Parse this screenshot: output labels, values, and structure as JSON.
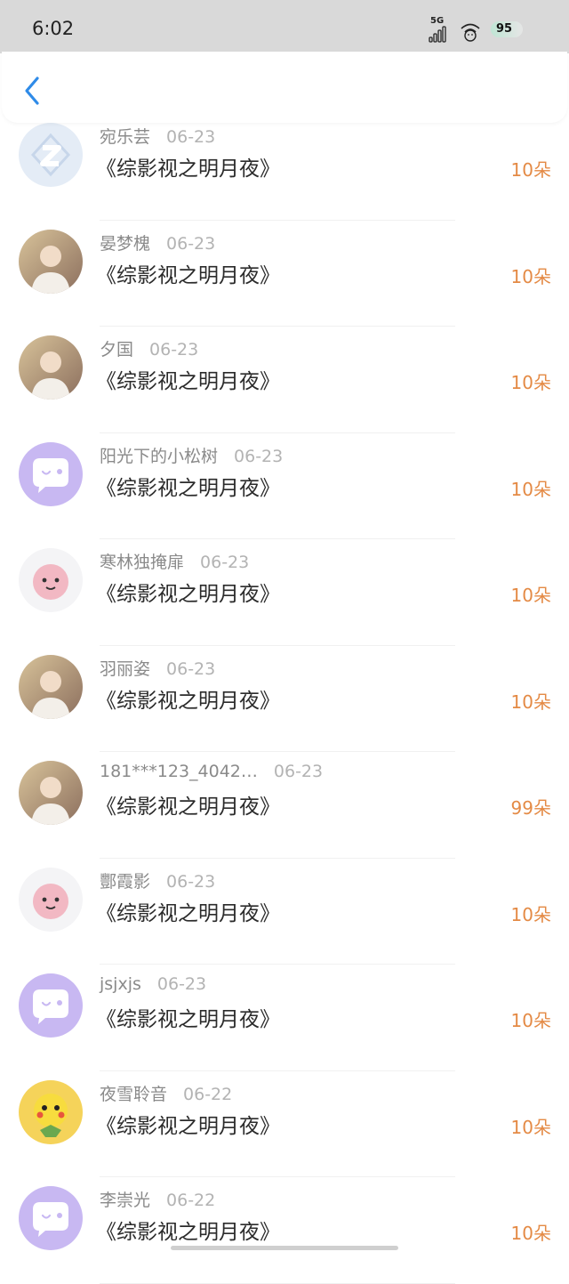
{
  "status_bar": {
    "time": "6:02",
    "network": "5G",
    "battery": "95"
  },
  "colors": {
    "accent_blue": "#2f8be8",
    "amount_orange": "#e48a45",
    "default_avatar_purple": "#c8b8f2"
  },
  "gifts": [
    {
      "name": "宛乐芸",
      "date": "06-23",
      "title": "《综影视之明月夜》",
      "amount": "10朵",
      "avatar": "qq-default-avatar"
    },
    {
      "name": "晏梦槐",
      "date": "06-23",
      "title": "《综影视之明月夜》",
      "amount": "10朵",
      "avatar": "photo-avatar"
    },
    {
      "name": "夕国",
      "date": "06-23",
      "title": "《综影视之明月夜》",
      "amount": "10朵",
      "avatar": "photo-avatar"
    },
    {
      "name": "阳光下的小松树",
      "date": "06-23",
      "title": "《综影视之明月夜》",
      "amount": "10朵",
      "avatar": "chat-bubble-avatar"
    },
    {
      "name": "寒林独掩扉",
      "date": "06-23",
      "title": "《综影视之明月夜》",
      "amount": "10朵",
      "avatar": "cartoon-avatar"
    },
    {
      "name": "羽丽姿",
      "date": "06-23",
      "title": "《综影视之明月夜》",
      "amount": "10朵",
      "avatar": "photo-avatar"
    },
    {
      "name": "181***123_4042…",
      "date": "06-23",
      "title": "《综影视之明月夜》",
      "amount": "99朵",
      "avatar": "photo-avatar"
    },
    {
      "name": "酆霞影",
      "date": "06-23",
      "title": "《综影视之明月夜》",
      "amount": "10朵",
      "avatar": "cartoon-avatar"
    },
    {
      "name": "jsjxjs",
      "date": "06-23",
      "title": "《综影视之明月夜》",
      "amount": "10朵",
      "avatar": "chat-bubble-avatar"
    },
    {
      "name": "夜雪聆音",
      "date": "06-22",
      "title": "《综影视之明月夜》",
      "amount": "10朵",
      "avatar": "pikachu-avatar"
    },
    {
      "name": "李崇光",
      "date": "06-22",
      "title": "《综影视之明月夜》",
      "amount": "10朵",
      "avatar": "chat-bubble-avatar"
    }
  ]
}
